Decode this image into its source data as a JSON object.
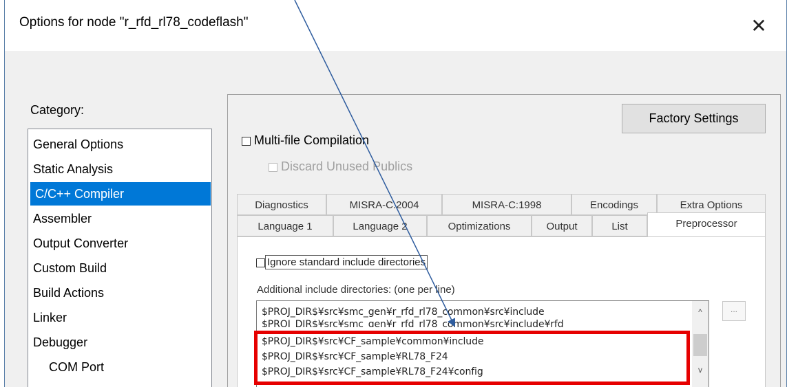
{
  "window": {
    "title": "Options for node \"r_rfd_rl78_codeflash\"",
    "close_glyph": "✕"
  },
  "category": {
    "label": "Category:",
    "items": [
      {
        "label": "General Options"
      },
      {
        "label": "Static Analysis"
      },
      {
        "label": "C/C++ Compiler",
        "selected": true
      },
      {
        "label": "Assembler"
      },
      {
        "label": "Output Converter"
      },
      {
        "label": "Custom Build"
      },
      {
        "label": "Build Actions"
      },
      {
        "label": "Linker"
      },
      {
        "label": "Debugger"
      },
      {
        "label": "COM Port",
        "sub": true
      }
    ]
  },
  "options": {
    "factory_settings": "Factory Settings",
    "multi_file": "Multi-file Compilation",
    "discard_unused": "Discard Unused Publics"
  },
  "tabs": {
    "row1": [
      "Diagnostics",
      "MISRA-C:2004",
      "MISRA-C:1998",
      "Encodings",
      "Extra Options"
    ],
    "row2": [
      "Language 1",
      "Language 2",
      "Optimizations",
      "Output",
      "List",
      "Preprocessor"
    ],
    "active": "Preprocessor"
  },
  "preprocessor": {
    "ignore_std": "Ignore standard include directories",
    "additional_label": "Additional include directories: (one per line)",
    "browse": "...",
    "lines": [
      "$PROJ_DIR$¥src¥smc_gen¥r_rfd_rl78_common¥src¥include",
      "$PROJ_DIR$¥src¥smc_gen¥r_rfd_rl78_common¥src¥include¥rfd",
      "$PROJ_DIR$¥src¥CF_sample¥common¥include",
      "$PROJ_DIR$¥src¥CF_sample¥RL78_F24",
      "$PROJ_DIR$¥src¥CF_sample¥RL78_F24¥config"
    ]
  },
  "annotation": {
    "highlight_color": "#e60000",
    "arrow_color": "#2e5c9e"
  },
  "scroll": {
    "up_glyph": "^",
    "down_glyph": "v"
  }
}
